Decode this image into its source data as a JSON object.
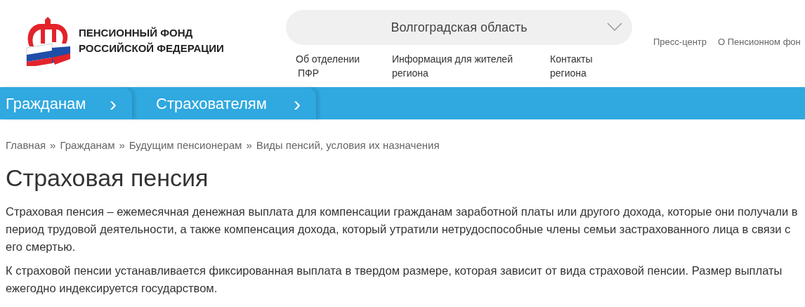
{
  "logo": {
    "line_1": "ПЕНСИОННЫЙ ФОНД",
    "line_2": "РОССИЙСКОЙ ФЕДЕРАЦИИ"
  },
  "region_select": {
    "value": "Волгоградская область"
  },
  "region_links": [
    {
      "line_1": "Об отделении",
      "line_2": "ПФР"
    },
    {
      "line_1": "Информация для жителей",
      "line_2": "региона"
    },
    {
      "line_1": "Контакты",
      "line_2": "региона"
    }
  ],
  "top_links": [
    "Пресс-центр",
    "О Пенсионном фон"
  ],
  "main_menu": [
    {
      "label": "Гражданам",
      "arrow": "›"
    },
    {
      "label": "Страхователям",
      "arrow": "›"
    }
  ],
  "breadcrumbs": {
    "items": [
      "Главная",
      "Гражданам",
      "Будущим пенсионерам",
      "Виды пенсий, условия их назначения"
    ],
    "separator": "»"
  },
  "title": "Страховая пенсия",
  "paragraphs": [
    "Страховая пенсия – ежемесячная денежная выплата для компенсации гражданам заработной платы или другого дохода, которые они получали в период трудовой деятельности, а также компенсация дохода, который утратили нетрудоспособные члены семьи застрахованного лица в связи с его смертью.",
    "К страховой пенсии устанавливается фиксированная выплата в твердом размере, которая зависит от вида страховой пенсии. Размер выплаты ежегодно индексируется государством."
  ]
}
